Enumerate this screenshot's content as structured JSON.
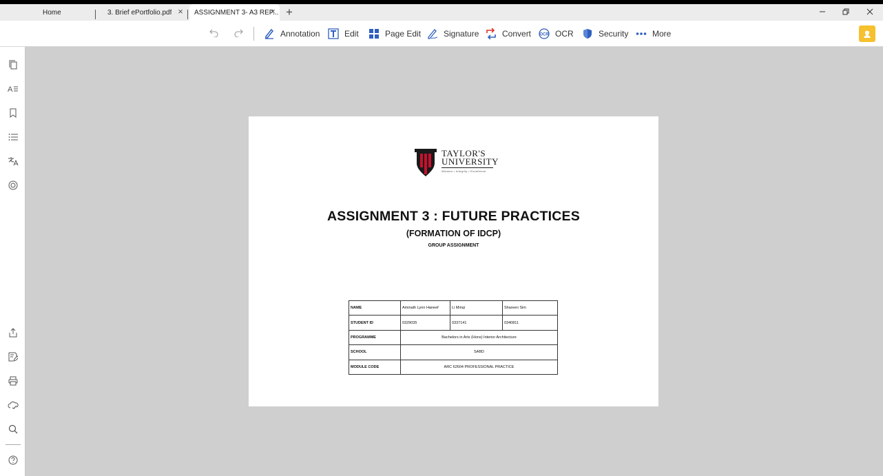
{
  "tabs": [
    {
      "label": "Home",
      "closable": false,
      "active": false
    },
    {
      "label": "3. Brief ePortfolio.pdf",
      "closable": true,
      "active": false
    },
    {
      "label": "ASSIGNMENT 3- A3 REP...",
      "closable": true,
      "active": true
    }
  ],
  "toolbar": {
    "items": [
      {
        "label": "Annotation",
        "icon": "pen-icon"
      },
      {
        "label": "Edit",
        "icon": "text-edit-icon"
      },
      {
        "label": "Page Edit",
        "icon": "grid-icon"
      },
      {
        "label": "Signature",
        "icon": "signature-icon"
      },
      {
        "label": "Convert",
        "icon": "convert-icon"
      },
      {
        "label": "OCR",
        "icon": "ocr-icon"
      },
      {
        "label": "Security",
        "icon": "shield-icon"
      },
      {
        "label": "More",
        "icon": "ellipsis-icon"
      }
    ]
  },
  "colors": {
    "accent": "#2f5fbf",
    "convert": "#d9342b",
    "premium": "#f6c12e",
    "canvas": "#cfcfcf"
  },
  "document": {
    "logo": {
      "line1": "TAYLOR'S",
      "line2": "UNIVERSITY",
      "tagline": "Wisdom • Integrity • Excellence"
    },
    "title": "ASSIGNMENT 3 : FUTURE PRACTICES",
    "subtitle": "(FORMATION OF IDCP)",
    "subtitle2": "GROUP ASSIGNMENT",
    "table": {
      "name_label": "NAME",
      "names": [
        "Aminath Lynn Haneef",
        "Li Minqi",
        "Shareen Sim"
      ],
      "id_label": "STUDENT ID",
      "ids": [
        "0329035",
        "0337141",
        "0340811"
      ],
      "programme_label": "PROGRAMME",
      "programme": "Bachelors in Arts (Hons) Interior Architecture",
      "school_label": "SCHOOL",
      "school": "SABD",
      "module_label": "MODULE CODE",
      "module": "ARC 62604 PROFESSIONAL PRACTICE"
    }
  }
}
